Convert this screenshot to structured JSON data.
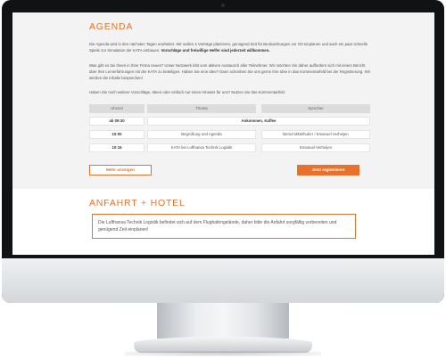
{
  "agenda": {
    "title": "AGENDA",
    "intro": {
      "text": "Die Agenda wird in den nächsten Tagen erarbeitet. Wir wollen 4 Vorträge platzieren, genügend Zeit für Beobachtungen vor Ort einplanen und auch ein paar schnelle Spiele zur Simulation der KATA einbauen. ",
      "bold": "Vorschläge und freiwillige Helfer sind jederzeit willkommen."
    },
    "paragraph2": "Was gibt es bei Ihnen in Ihrer Firma neues? Unser Netzwerk lebt vom aktiven Austausch aller Teilnehmer. Wir möchten Sie daher auffordern sich mit einem Bericht über Ihre Lernerfahrungen mit der KATA zu beteiligen. Haben Sie eine Idee? Dann schreiben Sie uns gerne Ihre Idee in das Kommentarfeld bei der Registrierung. Wir werden die Inhalte besprechen!",
    "paragraph3": "Haben Sie noch weitere Vorschläge, Ideen oder einfach nur einen Hinweis für uns? Nutzen Sie das Kommentarfeld.",
    "table": {
      "headers": [
        "Uhrzeit",
        "Thema",
        "Sprecher"
      ],
      "row1": {
        "time": "ab 09:30",
        "merged": "Ankommen, Kaffee"
      },
      "row2": {
        "time": "10:00",
        "topic": "Begrüßung und Agenda",
        "speaker": "Bernd Mittelhuber / Emanuel Verheijen"
      },
      "row3": {
        "time": "10:15",
        "topic": "KATA bei Lufthansa Technik Logistik",
        "speaker": "Emanuel Verheijen"
      }
    },
    "buttons": {
      "more": "Mehr anzeigen",
      "register": "Jetzt registrieren"
    }
  },
  "anfahrt": {
    "title": "ANFAHRT + HOTEL",
    "text": "Die Lufthansa Technik Logistik befindet sich auf dem Flughafengelände, daher bitte die Anfahrt sorgfältig vorbereiten und genügend Zeit einplanen!"
  },
  "colors": {
    "accent": "#e8722c",
    "section_bg": "#f3f3f3",
    "table_header": "#dcdcdc"
  }
}
